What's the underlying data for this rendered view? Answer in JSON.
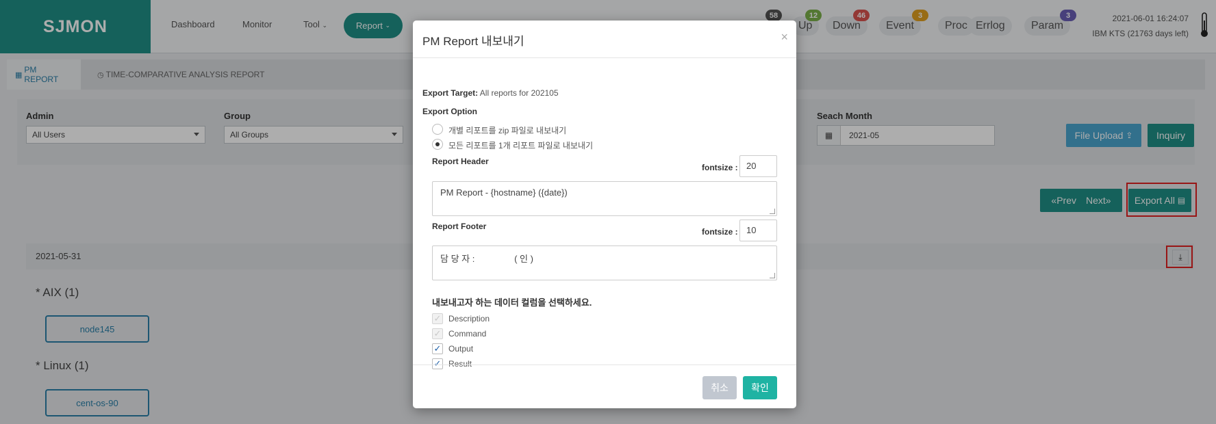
{
  "app": {
    "logo": "SJMON"
  },
  "nav": {
    "dashboard": "Dashboard",
    "monitor": "Monitor",
    "tool": "Tool",
    "report": "Report"
  },
  "status": {
    "up": {
      "label": "Up",
      "count": "12"
    },
    "down": {
      "label": "Down",
      "count": "46"
    },
    "event": {
      "label": "Event",
      "count": "3"
    },
    "proc": {
      "label": "Proc"
    },
    "errlog": {
      "label": "Errlog"
    },
    "param": {
      "label": "Param",
      "count": "3"
    },
    "hidden_count": "58"
  },
  "clock": {
    "datetime": "2021-06-01 16:24:07",
    "license": "IBM KTS (21763 days left)"
  },
  "tabs": {
    "pm": "PM REPORT",
    "time": "TIME-COMPARATIVE ANALYSIS REPORT"
  },
  "filters": {
    "admin_label": "Admin",
    "admin_value": "All Users",
    "group_label": "Group",
    "group_value": "All Groups",
    "month_label": "Seach Month",
    "month_value": "2021-05"
  },
  "buttons": {
    "file_upload": "File Upload",
    "inquiry": "Inquiry",
    "prev": "Prev",
    "next": "Next",
    "export_all": "Export All"
  },
  "list": {
    "date": "2021-05-31",
    "sections": [
      {
        "title": "* AIX (1)",
        "node": "node145"
      },
      {
        "title": "* Linux (1)",
        "node": "cent-os-90"
      }
    ]
  },
  "modal": {
    "title": "PM Report 내보내기",
    "close": "×",
    "export_target_label": "Export Target:",
    "export_target_value": "All reports for 202105",
    "export_option_label": "Export Option",
    "option_zip": "개별 리포트를 zip 파일로 내보내기",
    "option_single": "모든 리포트를 1개 리포트 파일로 내보내기",
    "header_label": "Report Header",
    "header_fontsize_label": "fontsize :",
    "header_fontsize": "20",
    "header_text": "PM Report - {hostname} ({date})",
    "footer_label": "Report Footer",
    "footer_fontsize_label": "fontsize :",
    "footer_fontsize": "10",
    "footer_text": "담 당 자 :                ( 인 )",
    "columns_prompt": "내보내고자 하는 데이터 컬럼을 선택하세요.",
    "columns": [
      "Description",
      "Command",
      "Output",
      "Result"
    ],
    "cancel": "취소",
    "confirm": "확인"
  },
  "colors": {
    "brand": "#1f8f86",
    "link": "#2a7fa8",
    "highlight": "#e02020",
    "confirm": "#1fb3a3",
    "cancel": "#c1c7d0"
  }
}
